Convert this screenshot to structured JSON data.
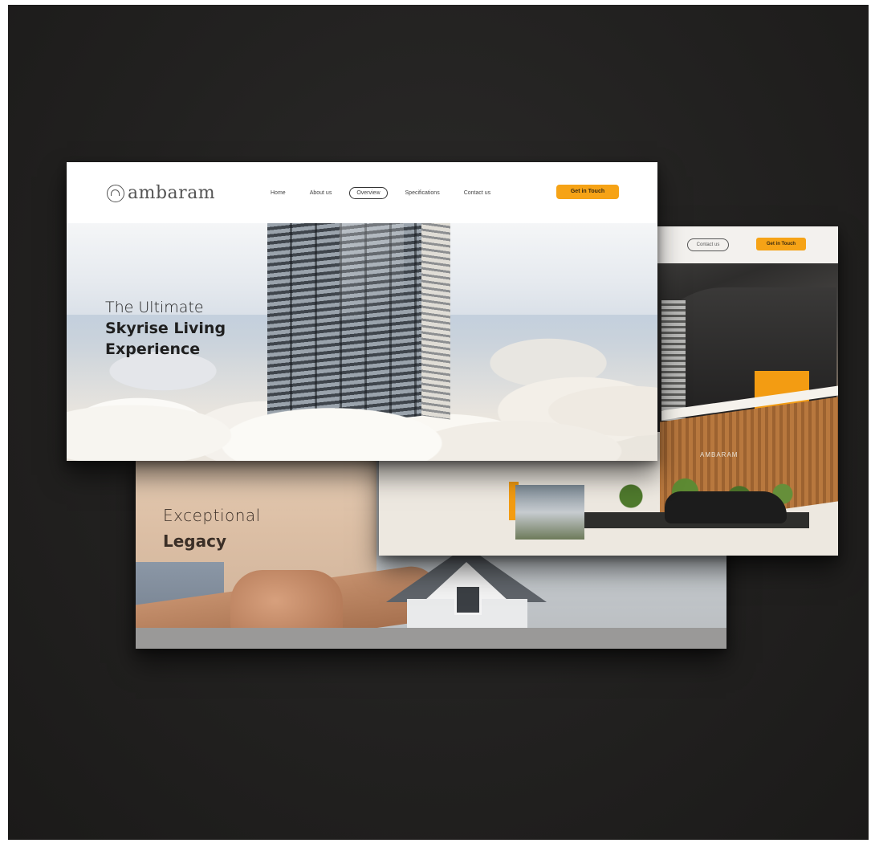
{
  "hero": {
    "logo_text": "ambaram",
    "nav": [
      "Home",
      "About us",
      "Overview",
      "Specifications",
      "Contact us"
    ],
    "active_nav_index": 2,
    "cta_label": "Get in Touch",
    "headline_line1": "The Ultimate",
    "headline_line2": "Skyrise Living",
    "headline_line3": "Experience"
  },
  "facade_page": {
    "nav_pill_label": "Contact us",
    "cta_label": "Get in Touch",
    "sign_text": "AMBARAM"
  },
  "legacy_page": {
    "line1": "Exceptional",
    "line2": "Legacy"
  },
  "colors": {
    "accent": "#f6a316",
    "background": "#232221",
    "text_dark": "#1f1f1f"
  }
}
